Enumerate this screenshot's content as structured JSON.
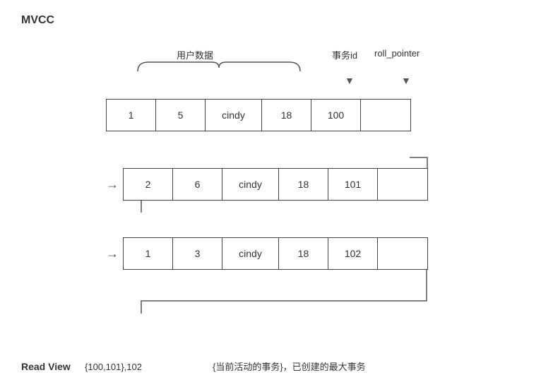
{
  "title": "MVCC",
  "labels": {
    "user_data": "用户数据",
    "trx_id": "事务id",
    "roll_pointer": "roll_pointer"
  },
  "rows": [
    {
      "indent": false,
      "cells": [
        "1",
        "5",
        "cindy",
        "18",
        "100",
        ""
      ]
    },
    {
      "indent": true,
      "cells": [
        "2",
        "6",
        "cindy",
        "18",
        "101",
        ""
      ]
    },
    {
      "indent": true,
      "cells": [
        "1",
        "3",
        "cindy",
        "18",
        "102",
        ""
      ]
    }
  ],
  "read_view": {
    "label": "Read View",
    "values": "{100,101},102",
    "description": "{当前活动的事务}，已创建的最大事务"
  }
}
